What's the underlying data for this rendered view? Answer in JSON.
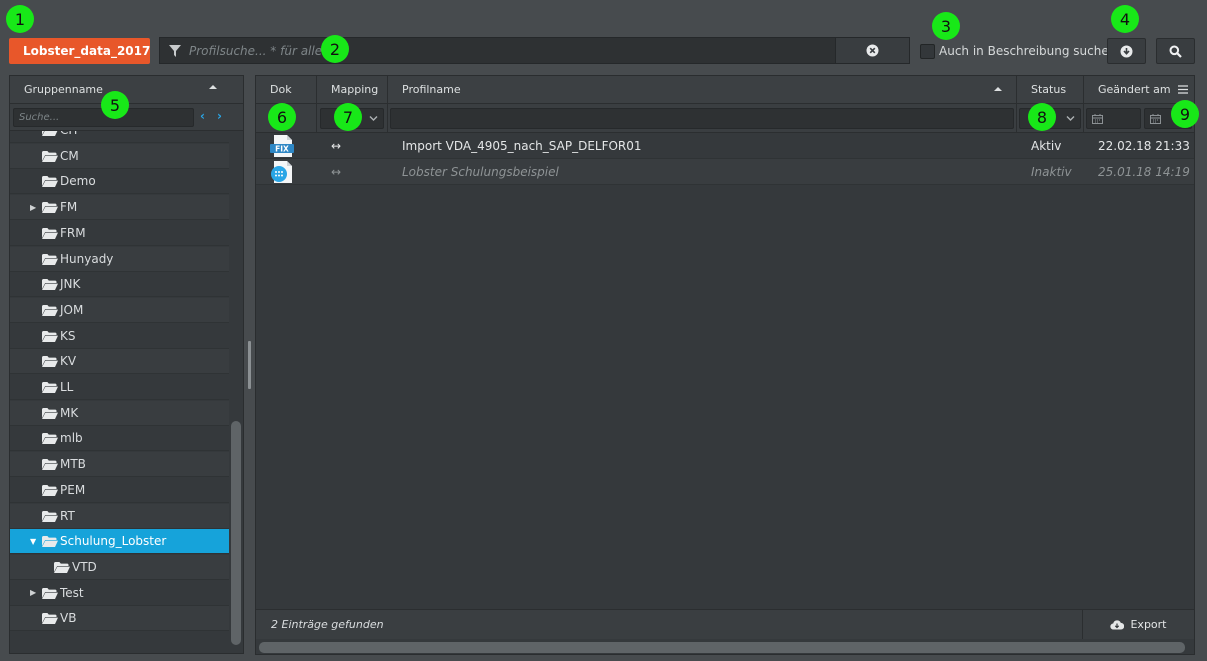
{
  "toolbar": {
    "repository_label": "Lobster_data_2017",
    "search_placeholder": "Profilsuche... * für alle",
    "desc_checkbox_label": "Auch in Beschreibung suchen"
  },
  "callouts": [
    "1",
    "2",
    "3",
    "4",
    "5",
    "6",
    "7",
    "8",
    "9"
  ],
  "left_panel": {
    "header": "Gruppenname",
    "filter_placeholder": "Suche...",
    "tree": [
      {
        "label": "CH",
        "expandable": false,
        "level": 0,
        "selected": false
      },
      {
        "label": "CM",
        "expandable": false,
        "level": 0,
        "selected": false
      },
      {
        "label": "Demo",
        "expandable": false,
        "level": 0,
        "selected": false
      },
      {
        "label": "FM",
        "expandable": true,
        "level": 0,
        "selected": false
      },
      {
        "label": "FRM",
        "expandable": false,
        "level": 0,
        "selected": false
      },
      {
        "label": "Hunyady",
        "expandable": false,
        "level": 0,
        "selected": false
      },
      {
        "label": "JNK",
        "expandable": false,
        "level": 0,
        "selected": false
      },
      {
        "label": "JOM",
        "expandable": false,
        "level": 0,
        "selected": false
      },
      {
        "label": "KS",
        "expandable": false,
        "level": 0,
        "selected": false
      },
      {
        "label": "KV",
        "expandable": false,
        "level": 0,
        "selected": false
      },
      {
        "label": "LL",
        "expandable": false,
        "level": 0,
        "selected": false
      },
      {
        "label": "MK",
        "expandable": false,
        "level": 0,
        "selected": false
      },
      {
        "label": "mlb",
        "expandable": false,
        "level": 0,
        "selected": false
      },
      {
        "label": "MTB",
        "expandable": false,
        "level": 0,
        "selected": false
      },
      {
        "label": "PEM",
        "expandable": false,
        "level": 0,
        "selected": false
      },
      {
        "label": "RT",
        "expandable": false,
        "level": 0,
        "selected": false
      },
      {
        "label": "Schulung_Lobster",
        "expandable": true,
        "expanded": true,
        "level": 0,
        "selected": true
      },
      {
        "label": "VTD",
        "expandable": false,
        "level": 1,
        "selected": false
      },
      {
        "label": "Test",
        "expandable": true,
        "level": 0,
        "selected": false
      },
      {
        "label": "VB",
        "expandable": false,
        "level": 0,
        "selected": false
      }
    ]
  },
  "grid": {
    "columns": {
      "dok": "Dok",
      "mapping": "Mapping",
      "profilname": "Profilname",
      "status": "Status",
      "geaendert": "Geändert am"
    },
    "rows": [
      {
        "doc_icon": "fix-document-icon",
        "doc_badge": "FIX",
        "mapping": "↔",
        "profilname": "Import VDA_4905_nach_SAP_DELFOR01",
        "status": "Aktiv",
        "geaendert": "22.02.18 21:33",
        "active": true
      },
      {
        "doc_icon": "csv-document-icon",
        "doc_badge": "",
        "mapping": "↔",
        "profilname": "Lobster Schulungsbeispiel",
        "status": "Inaktiv",
        "geaendert": "25.01.18 14:19",
        "active": false
      }
    ],
    "footer_count": "2 Einträge gefunden",
    "export_label": "Export"
  },
  "colors": {
    "background": "#474b4e",
    "accent_orange": "#e8572a",
    "selection_blue": "#16a3da",
    "callout_green": "#18e818"
  }
}
